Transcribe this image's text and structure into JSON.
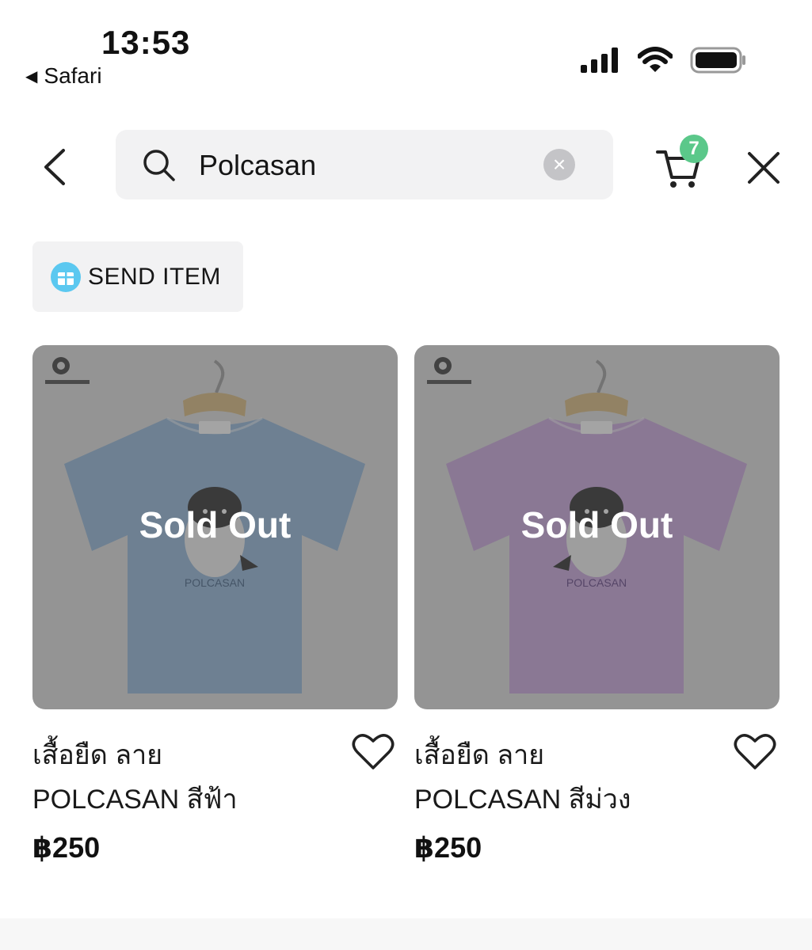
{
  "status_bar": {
    "time": "13:53",
    "back_app": "Safari",
    "icons": [
      "signal-icon",
      "wifi-icon",
      "battery-icon"
    ]
  },
  "search": {
    "query": "Polcasan",
    "icons": [
      "back-chevron-icon",
      "search-icon",
      "clear-icon"
    ]
  },
  "cart": {
    "badge_count": "7",
    "icon": "cart-icon"
  },
  "send_item": {
    "label": "SEND ITEM",
    "icon": "gift-icon"
  },
  "products": [
    {
      "image_overlay": "Sold Out",
      "title_line1": "เสื้อยืด ลาย",
      "title_line2": "POLCASAN สีฟ้า",
      "price": "฿250",
      "shirt_color": "#8fb5d9",
      "shirt_print": "POLCASAN"
    },
    {
      "image_overlay": "Sold Out",
      "title_line1": "เสื้อยืด ลาย",
      "title_line2": "POLCASAN สีม่วง",
      "price": "฿250",
      "shirt_color": "#c9a3dd",
      "shirt_print": "POLCASAN"
    }
  ],
  "colors": {
    "badge": "#5bc88a",
    "chip_bg": "#f2f2f3",
    "gift_icon": "#5bc8f0"
  }
}
